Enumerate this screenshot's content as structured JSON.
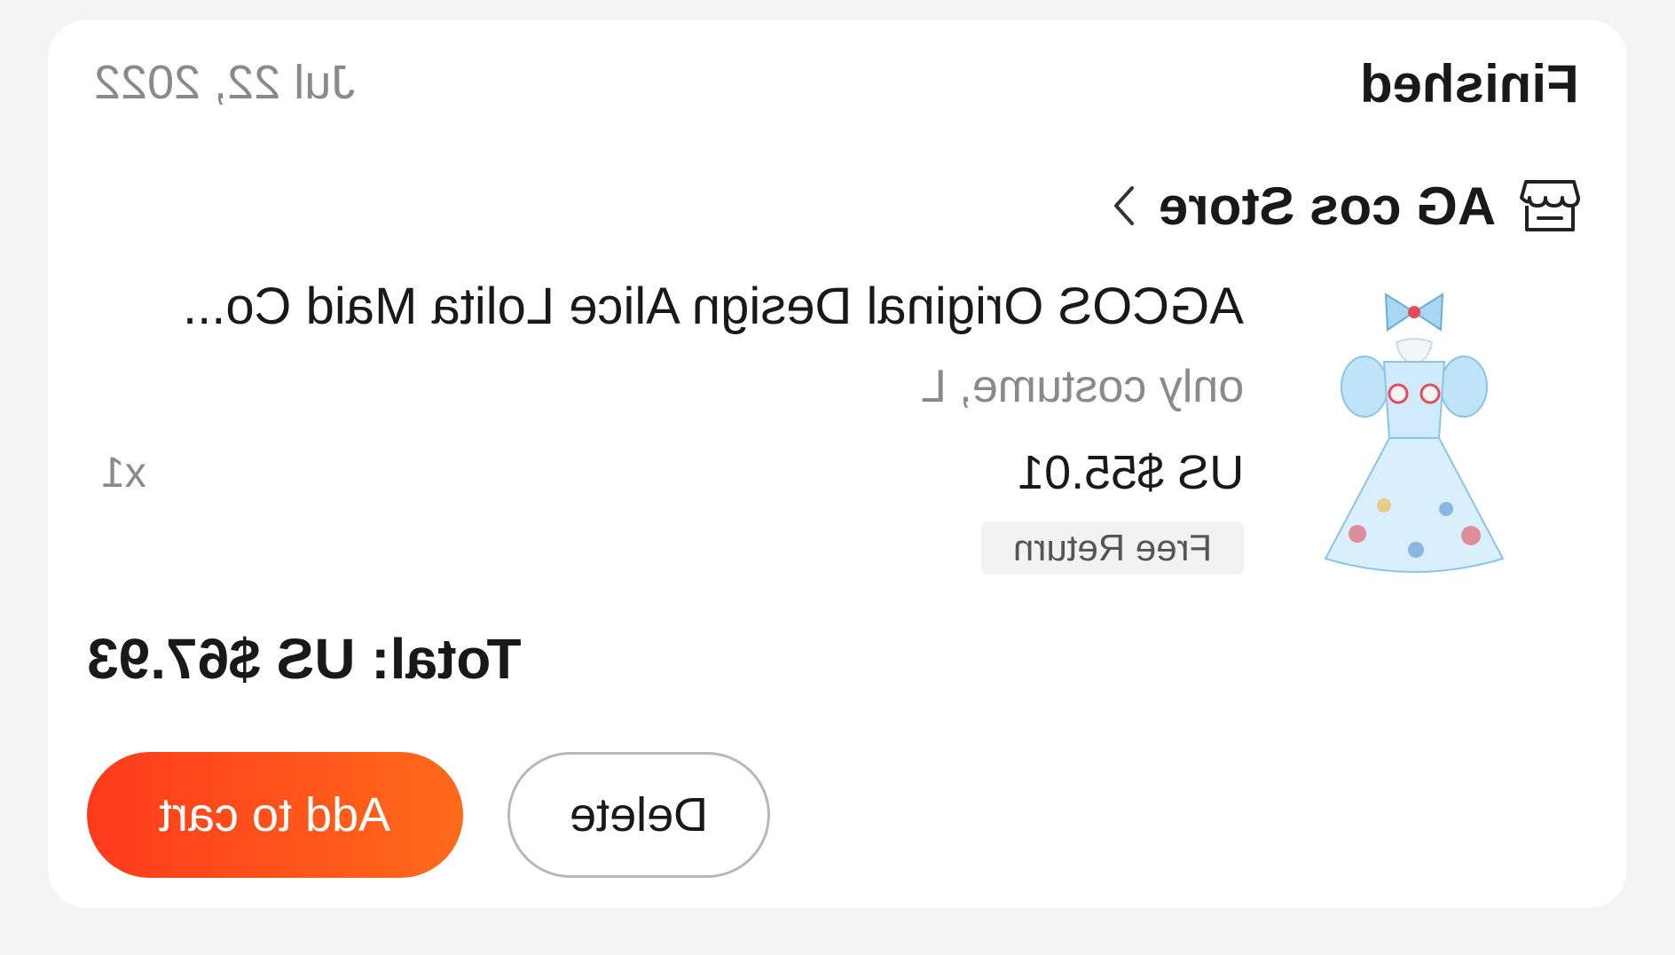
{
  "order": {
    "date": "Jul 22, 2022",
    "status": "Finished",
    "store_name": "AG cos Store",
    "store_icon": "store-icon",
    "chevron_icon": "chevron-right-icon",
    "total_label": "Total: US $67.93"
  },
  "item": {
    "title": "AGCOS Original Design Alice Lolita Maid Co...",
    "variant": "only costume, L",
    "price": "US $55.01",
    "quantity": "x1",
    "tag": "Free Return",
    "image": "product-image"
  },
  "actions": {
    "add_to_cart": "Add to cart",
    "delete": "Delete"
  },
  "colors": {
    "accent_start": "#ff3a1c",
    "accent_end": "#ff6a1a",
    "muted_text": "#8a8a8a"
  }
}
